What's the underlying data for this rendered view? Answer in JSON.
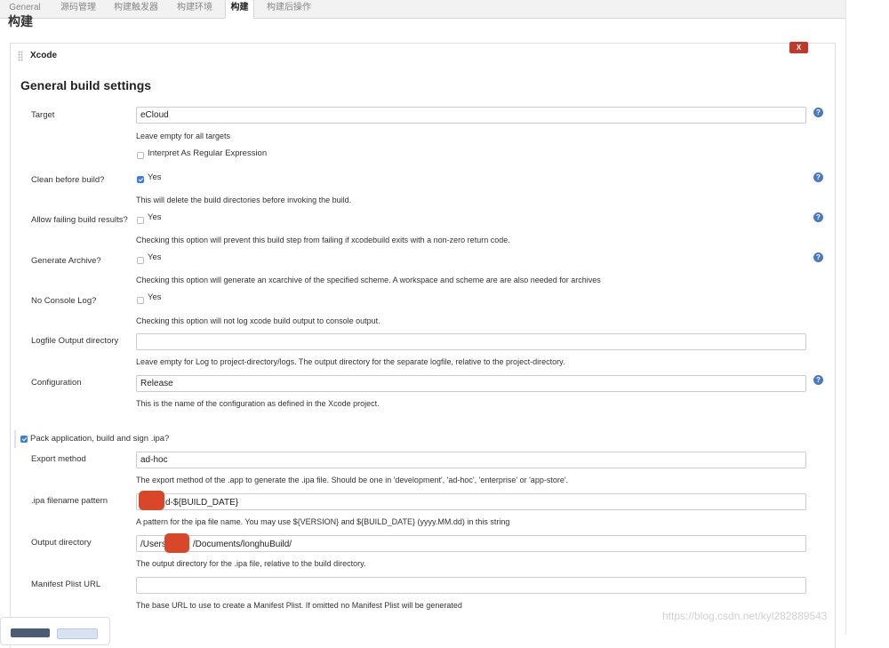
{
  "tabs": [
    "General",
    "源码管理",
    "构建触发器",
    "构建环境",
    "构建",
    "构建后操作"
  ],
  "section_title": "构建",
  "panel": {
    "name": "Xcode",
    "delete_label": "X"
  },
  "general_heading": "General build settings",
  "target": {
    "label": "Target",
    "value": "eCloud",
    "desc": "Leave empty for all targets",
    "regex_label": "Interpret As Regular Expression"
  },
  "clean": {
    "label": "Clean before build?",
    "option": "Yes",
    "desc": "This will delete the build directories before invoking the build."
  },
  "allow_failing": {
    "label": "Allow failing build results?",
    "option": "Yes",
    "desc": "Checking this option will prevent this build step from failing if xcodebuild exits with a non-zero return code."
  },
  "archive": {
    "label": "Generate Archive?",
    "option": "Yes",
    "desc": "Checking this option will generate an xcarchive of the specified scheme. A workspace and scheme are are also needed for archives"
  },
  "no_console": {
    "label": "No Console Log?",
    "option": "Yes",
    "desc": "Checking this option will not log xcode build output to console output."
  },
  "logfile": {
    "label": "Logfile Output directory",
    "value": "",
    "desc": "Leave empty for Log to project-directory/logs. The output directory for the separate logfile, relative to the project-directory."
  },
  "configuration": {
    "label": "Configuration",
    "value": "Release",
    "desc": "This is the name of the configuration as defined in the Xcode project."
  },
  "pack": {
    "label": "Pack application, build and sign .ipa?"
  },
  "export_method": {
    "label": "Export method",
    "value": "ad-hoc",
    "desc": "The export method of the .app to generate the .ipa file. Should be one in 'development', 'ad-hoc', 'enterprise' or 'app-store'."
  },
  "ipa_pattern": {
    "label": ".ipa filename pattern",
    "value": "d-${BUILD_DATE}",
    "desc": "A pattern for the ipa file name. You may use ${VERSION} and ${BUILD_DATE} (yyyy.MM.dd) in this string"
  },
  "output_dir": {
    "label": "Output directory",
    "value_prefix": "/Users",
    "value_suffix": "/Documents/longhuBuild/",
    "desc": "The output directory for the .ipa file, relative to the build directory."
  },
  "manifest": {
    "label": "Manifest Plist URL",
    "value": "",
    "desc": "The base URL to use to create a Manifest Plist. If omitted no Manifest Plist will be generated"
  },
  "watermark": "https://blog.csdn.net/kyl282889543",
  "help_glyph": "?",
  "colors": {
    "accent": "#3d7ed8",
    "delete": "#c0392b",
    "help": "#4a79c4",
    "redaction": "#d9472b"
  }
}
